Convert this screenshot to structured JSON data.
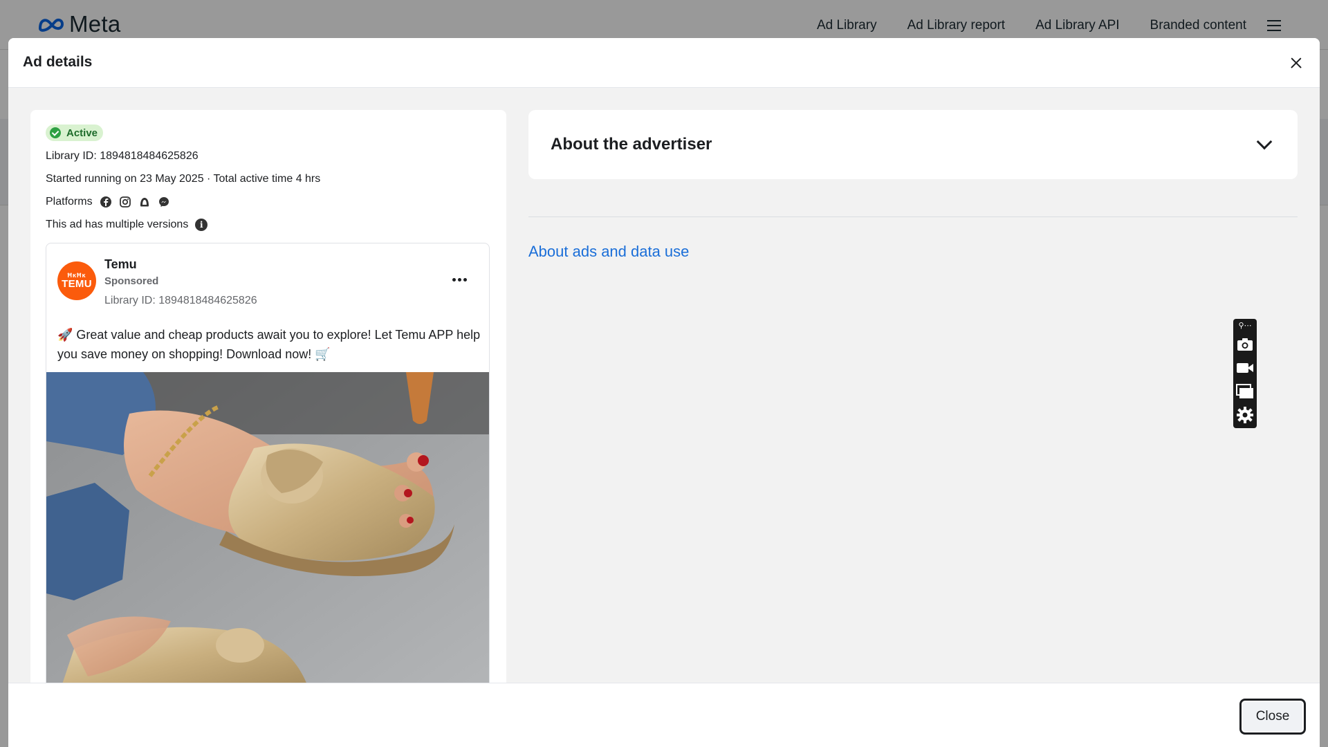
{
  "background": {
    "logo": {
      "text": "Meta",
      "icon": "meta-infinity-icon"
    },
    "nav": [
      {
        "label": "Ad Library"
      },
      {
        "label": "Ad Library report"
      },
      {
        "label": "Ad Library API"
      },
      {
        "label": "Branded content"
      }
    ],
    "menu_icon": "hamburger-menu-icon"
  },
  "modal": {
    "title": "Ad details",
    "close_icon": "close-icon",
    "footer": {
      "close_label": "Close"
    }
  },
  "ad": {
    "status": "Active",
    "library_id_line": "Library ID: 1894818484625826",
    "started_line": "Started running on 23 May 2025 · Total active time 4 hrs",
    "platforms_label": "Platforms",
    "platform_icons": [
      "facebook-icon",
      "instagram-icon",
      "audience-network-icon",
      "messenger-icon"
    ],
    "versions_line": "This ad has multiple versions",
    "post": {
      "advertiser": "Temu",
      "avatar_top": "ĦĸĦĸ",
      "avatar_text": "TEMU",
      "sponsored": "Sponsored",
      "library_id": "Library ID: 1894818484625826",
      "body": "🚀 Great value and cheap products await you to explore! Let Temu APP help you save money on shopping! Download now! 🛒",
      "image_subject": "sandals-photo"
    }
  },
  "right": {
    "about_advertiser_title": "About the advertiser",
    "about_ads_link": "About ads and data use"
  },
  "toolbar": {
    "icons": [
      "camera-icon",
      "video-icon",
      "window-icon",
      "settings-icon"
    ]
  },
  "colors": {
    "active_badge_bg": "#d9f2d0",
    "active_green": "#2ea043",
    "temu_orange": "#fb5b0c",
    "link_blue": "#1a6ed8"
  }
}
